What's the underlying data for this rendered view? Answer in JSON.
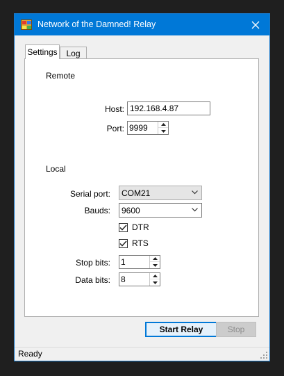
{
  "window": {
    "title": "Network of the Damned! Relay"
  },
  "tabs": [
    {
      "label": "Settings"
    },
    {
      "label": "Log"
    }
  ],
  "remote": {
    "legend": "Remote",
    "host_label": "Host:",
    "host_value": "192.168.4.87",
    "port_label": "Port:",
    "port_value": "9999"
  },
  "local": {
    "legend": "Local",
    "serial_port_label": "Serial port:",
    "serial_port_value": "COM21",
    "bauds_label": "Bauds:",
    "bauds_value": "9600",
    "dtr_label": "DTR",
    "dtr_checked": true,
    "rts_label": "RTS",
    "rts_checked": true,
    "stop_bits_label": "Stop bits:",
    "stop_bits_value": "1",
    "data_bits_label": "Data bits:",
    "data_bits_value": "8"
  },
  "buttons": {
    "start_label": "Start Relay",
    "stop_label": "Stop"
  },
  "status": {
    "text": "Ready"
  },
  "icons": [
    "app-icon",
    "close-icon",
    "spin-up-icon",
    "spin-down-icon",
    "dropdown-arrow-icon",
    "check-icon",
    "size-grip-icon"
  ]
}
